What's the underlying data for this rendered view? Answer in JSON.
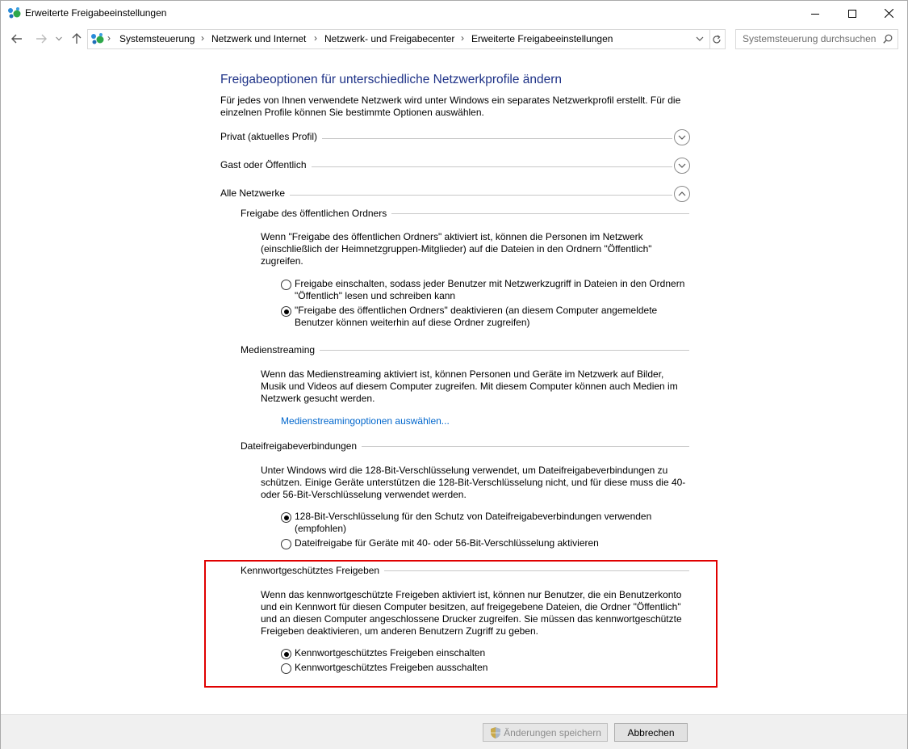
{
  "window": {
    "title": "Erweiterte Freigabeeinstellungen",
    "controls": {
      "minimize": "minimize",
      "maximize": "maximize",
      "close": "close"
    }
  },
  "nav": {
    "breadcrumbs": [
      "Systemsteuerung",
      "Netzwerk und Internet",
      "Netzwerk- und Freigabecenter",
      "Erweiterte Freigabeeinstellungen"
    ],
    "search_placeholder": "Systemsteuerung durchsuchen"
  },
  "main": {
    "heading": "Freigabeoptionen für unterschiedliche Netzwerkprofile ändern",
    "intro": "Für jedes von Ihnen verwendete Netzwerk wird unter Windows ein separates Netzwerkprofil erstellt. Für die einzelnen Profile können Sie bestimmte Optionen auswählen.",
    "intro_line1": "Für jedes von Ihnen verwendete Netzwerk wird unter Windows ein separates Netzwerkprofil erstellt. Für die",
    "intro_line2": "einzelnen Profile können Sie bestimmte Optionen auswählen.",
    "profiles": [
      {
        "label": "Privat (aktuelles Profil)",
        "expanded": false
      },
      {
        "label": "Gast oder Öffentlich",
        "expanded": false
      },
      {
        "label": "Alle Netzwerke",
        "expanded": true
      }
    ],
    "sections": {
      "public_folder": {
        "title": "Freigabe des öffentlichen Ordners",
        "desc1": "Wenn \"Freigabe des öffentlichen Ordners\" aktiviert ist, können die Personen im Netzwerk",
        "desc2": "(einschließlich der Heimnetzgruppen-Mitglieder) auf die Dateien in den Ordnern \"Öffentlich\"",
        "desc3": "zugreifen.",
        "opt1_l1": "Freigabe einschalten, sodass jeder Benutzer mit Netzwerkzugriff in Dateien in den Ordnern",
        "opt1_l2": "\"Öffentlich\" lesen und schreiben kann",
        "opt2_l1": "\"Freigabe des öffentlichen Ordners\" deaktivieren (an diesem Computer angemeldete",
        "opt2_l2": "Benutzer können weiterhin auf diese Ordner zugreifen)",
        "selected": 2
      },
      "media": {
        "title": "Medienstreaming",
        "desc1": "Wenn das Medienstreaming aktiviert ist, können Personen und Geräte im Netzwerk auf Bilder,",
        "desc2": "Musik und Videos auf diesem Computer zugreifen. Mit diesem Computer können auch Medien im",
        "desc3": "Netzwerk gesucht werden.",
        "link": "Medienstreamingoptionen auswählen..."
      },
      "file_sharing": {
        "title": "Dateifreigabeverbindungen",
        "desc1": "Unter Windows wird die 128-Bit-Verschlüsselung verwendet, um Dateifreigabeverbindungen zu",
        "desc2": "schützen. Einige Geräte unterstützen die 128-Bit-Verschlüsselung nicht, und für diese muss die 40-",
        "desc3": "oder 56-Bit-Verschlüsselung verwendet werden.",
        "opt1_l1": "128-Bit-Verschlüsselung für den Schutz von Dateifreigabeverbindungen verwenden",
        "opt1_l2": "(empfohlen)",
        "opt2_l1": "Dateifreigabe für Geräte mit 40- oder 56-Bit-Verschlüsselung aktivieren",
        "selected": 1
      },
      "password": {
        "title": "Kennwortgeschütztes Freigeben",
        "desc1": "Wenn das kennwortgeschützte Freigeben aktiviert ist, können nur Benutzer, die ein Benutzerkonto",
        "desc2": "und ein Kennwort für diesen Computer besitzen, auf freigegebene Dateien, die Ordner \"Öffentlich\"",
        "desc3": "und an diesen Computer angeschlossene Drucker zugreifen. Sie müssen das kennwortgeschützte",
        "desc4": "Freigeben deaktivieren, um anderen Benutzern Zugriff zu geben.",
        "opt1": "Kennwortgeschütztes Freigeben einschalten",
        "opt2": "Kennwortgeschütztes Freigeben ausschalten",
        "selected": 1
      }
    }
  },
  "footer": {
    "save_label": "Änderungen speichern",
    "cancel_label": "Abbrechen"
  },
  "colors": {
    "heading": "#1e3287",
    "link": "#0066cc",
    "highlight_border": "#e00000"
  }
}
